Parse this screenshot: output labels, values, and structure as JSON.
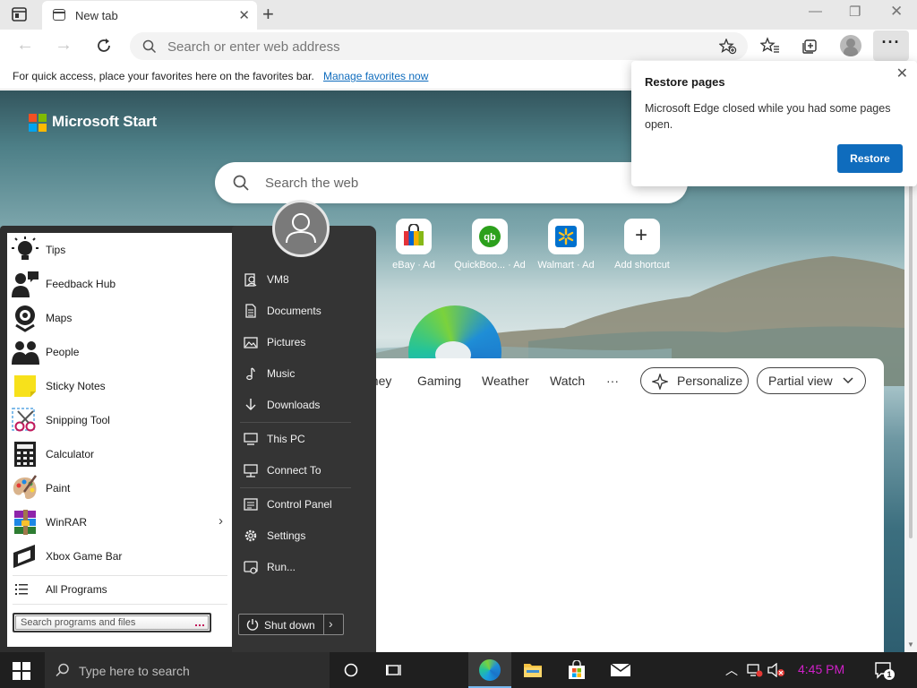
{
  "browser": {
    "tab_title": "New tab",
    "address_placeholder": "Search or enter web address",
    "favbar_text": "For quick access, place your favorites here on the favorites bar.",
    "favbar_link": "Manage favorites now",
    "menu_glyph": "···"
  },
  "page": {
    "brand": "Microsoft Start",
    "search_placeholder": "Search the web",
    "quick_links": [
      {
        "label": "eBay · Ad",
        "icon": "ebay-bag-icon"
      },
      {
        "label": "QuickBoo... · Ad",
        "icon": "quickbooks-icon"
      },
      {
        "label": "Walmart · Ad",
        "icon": "walmart-icon"
      },
      {
        "label": "Add shortcut",
        "icon": "plus-icon"
      }
    ],
    "feed_tabs": [
      "oney",
      "Gaming",
      "Weather",
      "Watch",
      "···"
    ],
    "personalize_label": "Personalize",
    "view_label": "Partial view"
  },
  "restore_popup": {
    "title": "Restore pages",
    "message": "Microsoft Edge closed while you had some pages open.",
    "button": "Restore"
  },
  "start_menu": {
    "programs": [
      {
        "label": "Tips"
      },
      {
        "label": "Feedback Hub"
      },
      {
        "label": "Maps"
      },
      {
        "label": "People"
      },
      {
        "label": "Sticky Notes"
      },
      {
        "label": "Snipping Tool"
      },
      {
        "label": "Calculator"
      },
      {
        "label": "Paint"
      },
      {
        "label": "WinRAR"
      },
      {
        "label": "Xbox Game Bar"
      }
    ],
    "all_programs": "All Programs",
    "search_placeholder": "Search programs and files",
    "places": [
      {
        "label": "VM8"
      },
      {
        "label": "Documents"
      },
      {
        "label": "Pictures"
      },
      {
        "label": "Music"
      },
      {
        "label": "Downloads"
      },
      {
        "label": "This PC"
      },
      {
        "label": "Connect To"
      },
      {
        "label": "Control Panel"
      },
      {
        "label": "Settings"
      },
      {
        "label": "Run..."
      }
    ],
    "shutdown": "Shut down"
  },
  "taskbar": {
    "search_placeholder": "Type here to search",
    "clock": "4:45 PM",
    "notification_count": "1",
    "accent": "#77b7ee"
  }
}
